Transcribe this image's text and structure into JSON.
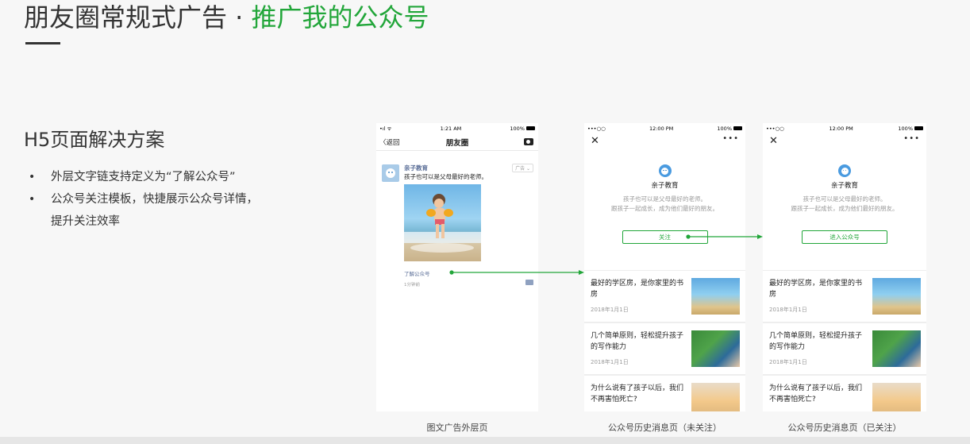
{
  "title": {
    "main": "朋友圈常规式广告 · ",
    "accent": "推广我的公众号"
  },
  "section_heading": "H5页面解决方案",
  "bullets": [
    {
      "dot": "•",
      "text": "外层文字链支持定义为“了解公众号”"
    },
    {
      "dot": "•",
      "text": "公众号关注模板，快捷展示公众号详情，"
    },
    {
      "dot": "",
      "text": "提升关注效率"
    }
  ],
  "phone1": {
    "signal": "•ıl ᯤ",
    "time": "1:21 AM",
    "battery": "100%",
    "back_label": "〈返回",
    "nav_title": "朋友圈",
    "account_name": "亲子教育",
    "ad_badge": "广告 ⌄",
    "post_text": "孩子也可以是父母最好的老师。",
    "link_text": "了解公众号",
    "post_time": "1分钟前",
    "caption": "图文广告外层页"
  },
  "profile_common": {
    "signal": "•••○○",
    "time": "12:00 PM",
    "battery": "100%",
    "close": "✕",
    "more": "•••",
    "name": "亲子教育",
    "desc_line1": "孩子也可以是父母最好的老师。",
    "desc_line2": "跟孩子一起成长，成为他们最好的朋友。"
  },
  "phone2": {
    "button": "关注",
    "caption": "公众号历史消息页（未关注）"
  },
  "phone3": {
    "button": "进入公众号",
    "caption": "公众号历史消息页（已关注）"
  },
  "articles": [
    {
      "title": "最好的学区房，是你家里的书房",
      "date": "2018年1月1日"
    },
    {
      "title": "几个简单原则，轻松提升孩子的写作能力",
      "date": "2018年1月1日"
    },
    {
      "title": "为什么说有了孩子以后，我们不再害怕死亡?",
      "date": ""
    }
  ],
  "colors": {
    "accent": "#22a63a",
    "link": "#576b95",
    "bg": "#f7f7f7"
  }
}
